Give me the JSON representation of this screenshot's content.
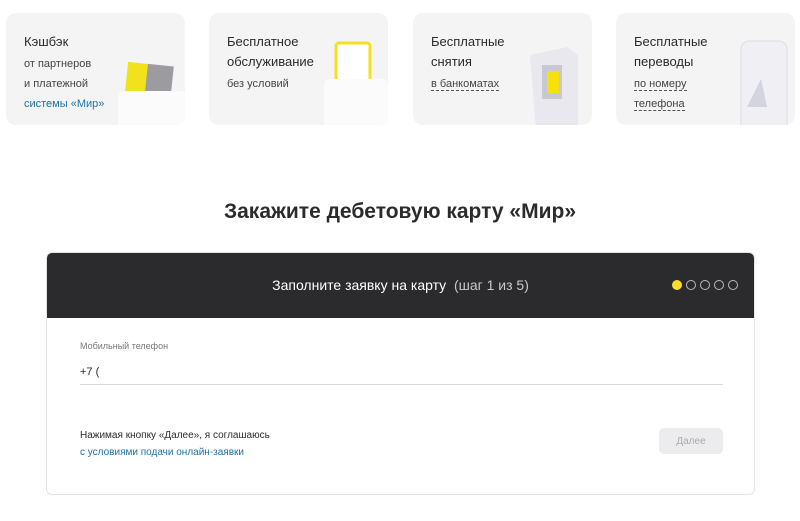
{
  "features": [
    {
      "title": "Кэшбэк",
      "lines": [
        "от партнеров",
        "и платежной",
        "системы «Мир»"
      ]
    },
    {
      "title": "Бесплатное обслуживание",
      "lines": [
        "без условий"
      ]
    },
    {
      "title": "Бесплатные снятия",
      "lines": [
        "в банкоматах"
      ]
    },
    {
      "title": "Бесплатные переводы",
      "lines": [
        "по номеру",
        "телефона"
      ]
    }
  ],
  "heading": "Закажите дебетовую карту «Мир»",
  "form": {
    "title": "Заполните заявку на карту",
    "step": "(шаг 1 из 5)",
    "current_step": 1,
    "total_steps": 5,
    "phone_label": "Мобильный телефон",
    "phone_value": "+7 (",
    "agree_text": "Нажимая кнопку «Далее», я соглашаюсь",
    "agree_link": "с условиями подачи онлайн-заявки",
    "next_label": "Далее"
  },
  "colors": {
    "accent": "#ffdd2d",
    "dark": "#2b2b2e",
    "link": "#1a73a8"
  }
}
